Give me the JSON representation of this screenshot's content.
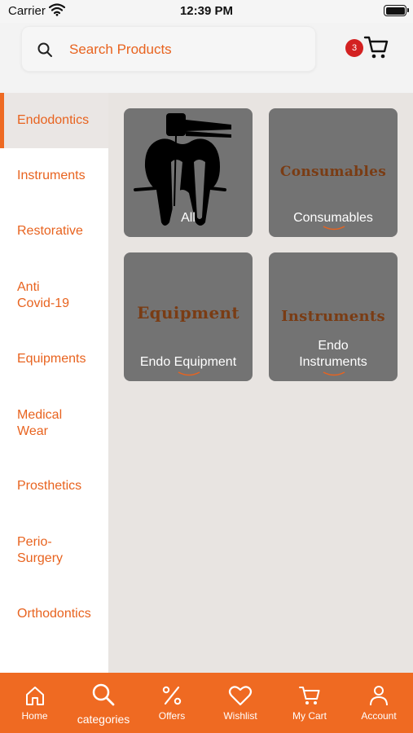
{
  "status_bar": {
    "carrier": "Carrier",
    "time": "12:39 PM"
  },
  "search": {
    "placeholder": "Search Products"
  },
  "cart": {
    "count": "3"
  },
  "sidebar": {
    "items": [
      {
        "label": "Endodontics",
        "active": true
      },
      {
        "label": "Instruments"
      },
      {
        "label": "Restorative"
      },
      {
        "label": "Anti Covid-19"
      },
      {
        "label": "Equipments"
      },
      {
        "label": "Medical Wear"
      },
      {
        "label": "Prosthetics"
      },
      {
        "label": "Perio-Surgery"
      },
      {
        "label": "Orthodontics"
      }
    ]
  },
  "tiles": [
    {
      "label": "All",
      "icon": "tooth-icon"
    },
    {
      "label": "Consumables",
      "art_text": "Consumables",
      "watermark": "market"
    },
    {
      "label": "Endo Equipment",
      "art_text": "Equipment",
      "watermark": "market"
    },
    {
      "label": "Endo Instruments",
      "art_text": "Instruments",
      "watermark": "market"
    }
  ],
  "bottom_nav": {
    "items": [
      {
        "label": "Home",
        "icon": "home-icon"
      },
      {
        "label": "categories",
        "icon": "search-icon"
      },
      {
        "label": "Offers",
        "icon": "percent-icon"
      },
      {
        "label": "Wishlist",
        "icon": "heart-icon"
      },
      {
        "label": "My Cart",
        "icon": "cart-icon"
      },
      {
        "label": "Account",
        "icon": "user-icon"
      }
    ]
  },
  "colors": {
    "accent": "#ef6a22",
    "badge": "#d32121",
    "tile": "#737373"
  }
}
